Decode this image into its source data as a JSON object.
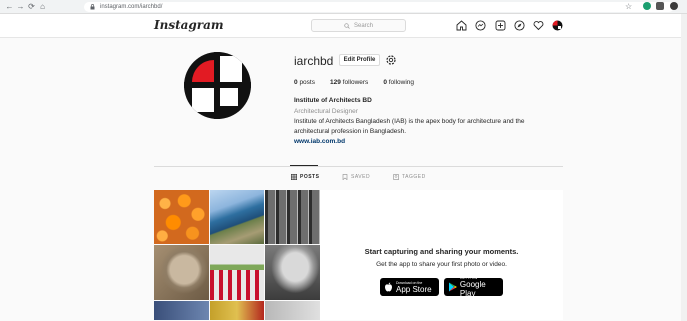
{
  "browser": {
    "url": "instagram.com/iarchbd/",
    "nav": [
      "←",
      "→",
      "⟳",
      "⌂"
    ]
  },
  "header": {
    "logo": "Instagram",
    "search_placeholder": "Search"
  },
  "profile": {
    "username": "iarchbd",
    "edit_label": "Edit Profile",
    "posts_count": "0",
    "posts_label": "posts",
    "followers_count": "129",
    "followers_label": "followers",
    "following_count": "0",
    "following_label": "following",
    "full_name": "Institute of Architects BD",
    "category": "Architectural Designer",
    "bio": "Institute of Architects Bangladesh (IAB) is the apex body for architecture and the architectural profession in Bangladesh.",
    "website": "www.iab.com.bd"
  },
  "tabs": [
    {
      "label": "POSTS",
      "active": true
    },
    {
      "label": "SAVED",
      "active": false
    },
    {
      "label": "TAGGED",
      "active": false
    }
  ],
  "promo": {
    "title": "Start capturing and sharing your moments.",
    "subtitle": "Get the app to share your first photo or video.",
    "appstore_small": "Download on the",
    "appstore_big": "App Store",
    "play_small": "GET IT ON",
    "play_big": "Google Play"
  },
  "colors": {
    "accent_link": "#00376b",
    "logo_red": "#e21b23"
  }
}
